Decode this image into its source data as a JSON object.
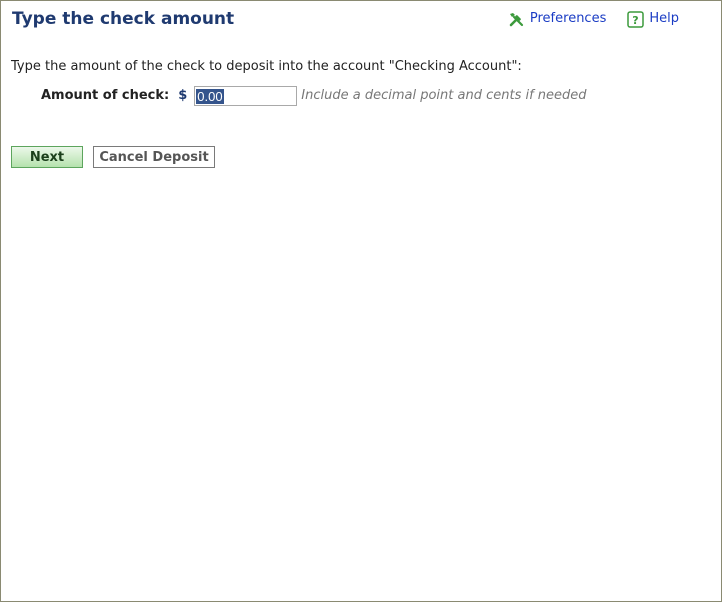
{
  "header": {
    "title": "Type the check amount",
    "links": [
      {
        "label": "Preferences",
        "icon": "wrench-screwdriver-icon"
      },
      {
        "label": "Help",
        "icon": "help-icon"
      }
    ]
  },
  "form": {
    "instruction": "Type the amount of the check to deposit into the account \"Checking Account\":",
    "amount_label": "Amount of check:",
    "currency_symbol": "$",
    "amount_value": "0.00",
    "hint": "Include a decimal point and cents if needed"
  },
  "buttons": {
    "next_label": "Next",
    "cancel_label": "Cancel Deposit"
  },
  "colors": {
    "title": "#1f3a70",
    "link": "#1a3cc4",
    "icon_green": "#3c9a3c",
    "next_button_top": "#ecf8ea",
    "next_button_bottom": "#b5e2ad",
    "selection": "#34548c"
  }
}
